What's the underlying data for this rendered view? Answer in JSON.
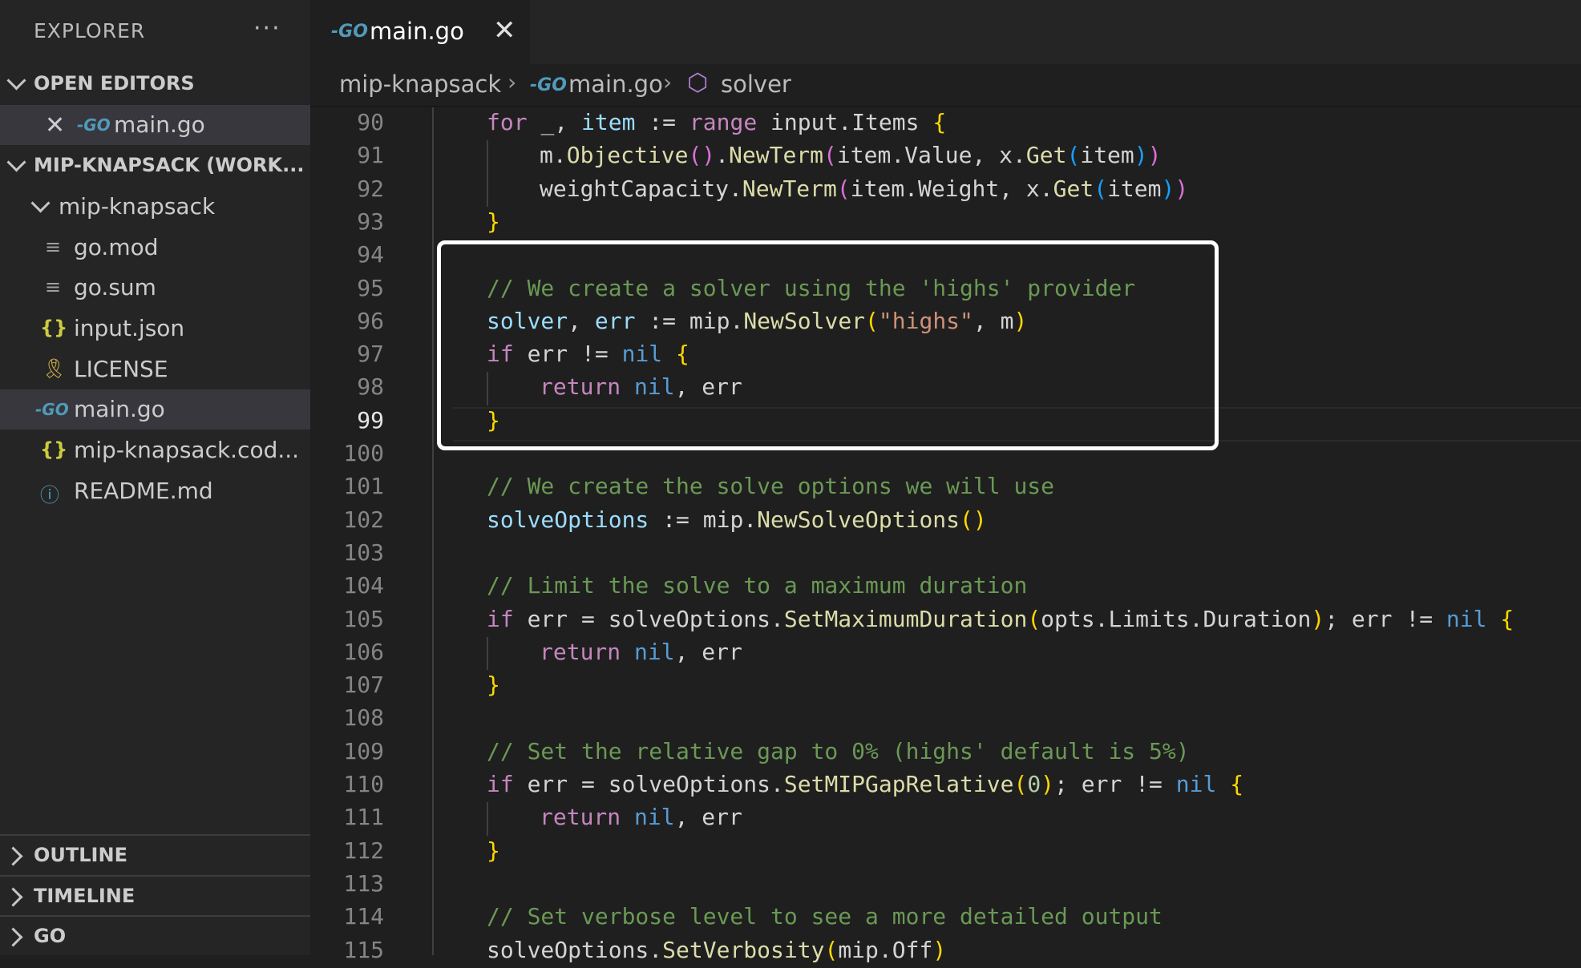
{
  "sidebar": {
    "title": "EXPLORER",
    "more": "···",
    "open_editors_label": "OPEN EDITORS",
    "open_editor_file": "main.go",
    "workspace_label": "MIP-KNAPSACK (WORK...",
    "folder_label": "mip-knapsack",
    "files": [
      {
        "name": "go.mod",
        "icon": "lines-icon"
      },
      {
        "name": "go.sum",
        "icon": "lines-icon"
      },
      {
        "name": "input.json",
        "icon": "json-icon"
      },
      {
        "name": "LICENSE",
        "icon": "license-icon"
      },
      {
        "name": "main.go",
        "icon": "go-icon"
      },
      {
        "name": "mip-knapsack.cod...",
        "icon": "json-icon"
      },
      {
        "name": "README.md",
        "icon": "info-icon"
      }
    ],
    "bottom_sections": [
      "OUTLINE",
      "TIMELINE",
      "GO"
    ]
  },
  "tab": {
    "label": "main.go",
    "close": "✕",
    "icon": "GO"
  },
  "breadcrumb": {
    "folder": "mip-knapsack",
    "file": "main.go",
    "symbol": "solver"
  },
  "code": {
    "active_line": 99,
    "lines": [
      {
        "n": 90,
        "tokens": [
          [
            "ctl",
            "for "
          ],
          [
            "txt",
            "_, "
          ],
          [
            "vr",
            "item"
          ],
          [
            "txt",
            " := "
          ],
          [
            "ctl",
            "range "
          ],
          [
            "txt",
            "input.Items "
          ],
          [
            "p1",
            "{"
          ]
        ]
      },
      {
        "n": 91,
        "tokens": [
          [
            "txt",
            "m."
          ],
          [
            "fn",
            "Objective"
          ],
          [
            "p2",
            "()"
          ],
          [
            "txt",
            "."
          ],
          [
            "fn",
            "NewTerm"
          ],
          [
            "p2",
            "("
          ],
          [
            "txt",
            "item.Value, x."
          ],
          [
            "fn",
            "Get"
          ],
          [
            "p3",
            "("
          ],
          [
            "txt",
            "item"
          ],
          [
            "p3",
            ")"
          ],
          [
            "p2",
            ")"
          ]
        ]
      },
      {
        "n": 92,
        "tokens": [
          [
            "txt",
            "weightCapacity."
          ],
          [
            "fn",
            "NewTerm"
          ],
          [
            "p2",
            "("
          ],
          [
            "txt",
            "item.Weight, x."
          ],
          [
            "fn",
            "Get"
          ],
          [
            "p3",
            "("
          ],
          [
            "txt",
            "item"
          ],
          [
            "p3",
            ")"
          ],
          [
            "p2",
            ")"
          ]
        ]
      },
      {
        "n": 93,
        "tokens": [
          [
            "p1",
            "}"
          ]
        ]
      },
      {
        "n": 94,
        "tokens": []
      },
      {
        "n": 95,
        "tokens": [
          [
            "cm",
            "// We create a solver using the 'highs' provider"
          ]
        ]
      },
      {
        "n": 96,
        "tokens": [
          [
            "vr",
            "solver"
          ],
          [
            "txt",
            ", "
          ],
          [
            "vr",
            "err"
          ],
          [
            "txt",
            " := mip."
          ],
          [
            "fn",
            "NewSolver"
          ],
          [
            "p1",
            "("
          ],
          [
            "str",
            "\"highs\""
          ],
          [
            "txt",
            ", m"
          ],
          [
            "p1",
            ")"
          ]
        ]
      },
      {
        "n": 97,
        "tokens": [
          [
            "ctl",
            "if "
          ],
          [
            "txt",
            "err != "
          ],
          [
            "kw",
            "nil "
          ],
          [
            "p1",
            "{"
          ]
        ]
      },
      {
        "n": 98,
        "tokens": [
          [
            "ctl",
            "return "
          ],
          [
            "kw",
            "nil"
          ],
          [
            "txt",
            ", err"
          ]
        ]
      },
      {
        "n": 99,
        "tokens": [
          [
            "p1",
            "}"
          ]
        ]
      },
      {
        "n": 100,
        "tokens": []
      },
      {
        "n": 101,
        "tokens": [
          [
            "cm",
            "// We create the solve options we will use"
          ]
        ]
      },
      {
        "n": 102,
        "tokens": [
          [
            "vr",
            "solveOptions"
          ],
          [
            "txt",
            " := mip."
          ],
          [
            "fn",
            "NewSolveOptions"
          ],
          [
            "p1",
            "()"
          ]
        ]
      },
      {
        "n": 103,
        "tokens": []
      },
      {
        "n": 104,
        "tokens": [
          [
            "cm",
            "// Limit the solve to a maximum duration"
          ]
        ]
      },
      {
        "n": 105,
        "tokens": [
          [
            "ctl",
            "if "
          ],
          [
            "txt",
            "err = solveOptions."
          ],
          [
            "fn",
            "SetMaximumDuration"
          ],
          [
            "p1",
            "("
          ],
          [
            "txt",
            "opts.Limits.Duration"
          ],
          [
            "p1",
            ")"
          ],
          [
            "txt",
            "; err != "
          ],
          [
            "kw",
            "nil "
          ],
          [
            "p1",
            "{"
          ]
        ]
      },
      {
        "n": 106,
        "tokens": [
          [
            "ctl",
            "return "
          ],
          [
            "kw",
            "nil"
          ],
          [
            "txt",
            ", err"
          ]
        ]
      },
      {
        "n": 107,
        "tokens": [
          [
            "p1",
            "}"
          ]
        ]
      },
      {
        "n": 108,
        "tokens": []
      },
      {
        "n": 109,
        "tokens": [
          [
            "cm",
            "// Set the relative gap to 0% (highs' default is 5%)"
          ]
        ]
      },
      {
        "n": 110,
        "tokens": [
          [
            "ctl",
            "if "
          ],
          [
            "txt",
            "err = solveOptions."
          ],
          [
            "fn",
            "SetMIPGapRelative"
          ],
          [
            "p1",
            "("
          ],
          [
            "num",
            "0"
          ],
          [
            "p1",
            ")"
          ],
          [
            "txt",
            "; err != "
          ],
          [
            "kw",
            "nil "
          ],
          [
            "p1",
            "{"
          ]
        ]
      },
      {
        "n": 111,
        "tokens": [
          [
            "ctl",
            "return "
          ],
          [
            "kw",
            "nil"
          ],
          [
            "txt",
            ", err"
          ]
        ]
      },
      {
        "n": 112,
        "tokens": [
          [
            "p1",
            "}"
          ]
        ]
      },
      {
        "n": 113,
        "tokens": []
      },
      {
        "n": 114,
        "tokens": [
          [
            "cm",
            "// Set verbose level to see a more detailed output"
          ]
        ]
      },
      {
        "n": 115,
        "tokens": [
          [
            "txt",
            "solveOptions."
          ],
          [
            "fn",
            "SetVerbosity"
          ],
          [
            "p1",
            "("
          ],
          [
            "txt",
            "mip.Off"
          ],
          [
            "p1",
            ")"
          ]
        ]
      }
    ]
  }
}
